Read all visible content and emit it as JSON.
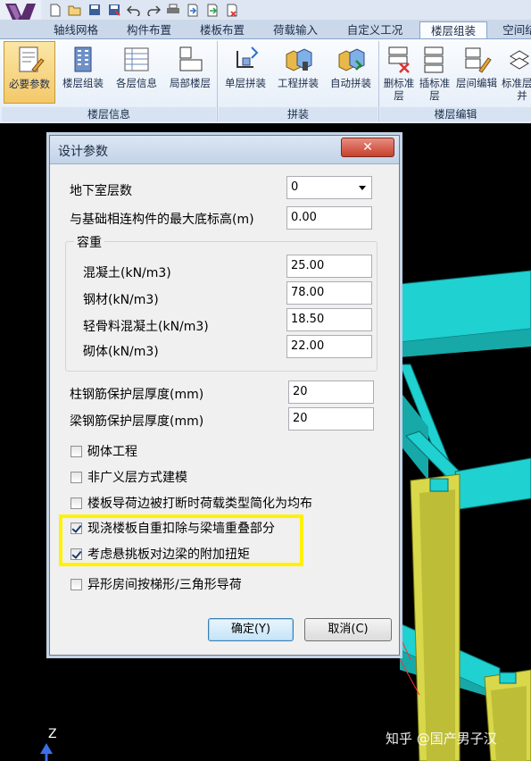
{
  "quick_access": {
    "icons": [
      "new-icon",
      "open-icon",
      "save-icon",
      "save-as-icon",
      "undo-icon",
      "redo-icon",
      "print-icon",
      "import-icon",
      "export-icon",
      "delete-file-icon"
    ]
  },
  "tabs": [
    {
      "label": "轴线网格"
    },
    {
      "label": "构件布置"
    },
    {
      "label": "楼板布置"
    },
    {
      "label": "荷载输入"
    },
    {
      "label": "自定义工况"
    },
    {
      "label": "楼层组装"
    },
    {
      "label": "空间结"
    }
  ],
  "ribbon": {
    "groups": [
      {
        "label": "楼层信息"
      },
      {
        "label": "拼装"
      },
      {
        "label": "楼层编辑"
      }
    ],
    "buttons": [
      {
        "label": "必要参数"
      },
      {
        "label": "楼层组装"
      },
      {
        "label": "各层信息"
      },
      {
        "label": "局部楼层"
      },
      {
        "label": "单层拼装"
      },
      {
        "label": "工程拼装"
      },
      {
        "label": "自动拼装"
      },
      {
        "label": "删标准层"
      },
      {
        "label": "插标准层"
      },
      {
        "label": "层间编辑"
      },
      {
        "label": "标准层合并"
      }
    ],
    "accent": "#f4c869"
  },
  "dialog": {
    "title": "设计参数",
    "close_label": "✕",
    "basement_label": "地下室层数",
    "basement_value": "0",
    "max_bottom_label": "与基础相连构件的最大底标高(m)",
    "max_bottom_value": "0.00",
    "density_group": "容重",
    "concrete_label": "混凝土(kN/m3)",
    "concrete_value": "25.00",
    "steel_label": "钢材(kN/m3)",
    "steel_value": "78.00",
    "lightweight_label": "轻骨料混凝土(kN/m3)",
    "lightweight_value": "18.50",
    "masonry_label": "砌体(kN/m3)",
    "masonry_value": "22.00",
    "col_cover_label": "柱钢筋保护层厚度(mm)",
    "col_cover_value": "20",
    "beam_cover_label": "梁钢筋保护层厚度(mm)",
    "beam_cover_value": "20",
    "checkboxes": [
      {
        "label": "砌体工程",
        "checked": false
      },
      {
        "label": "非广义层方式建模",
        "checked": false
      },
      {
        "label": "楼板导荷边被打断时荷载类型简化为均布",
        "checked": false
      },
      {
        "label": "现浇楼板自重扣除与梁墙重叠部分",
        "checked": true
      },
      {
        "label": "考虑悬挑板对边梁的附加扭矩",
        "checked": true
      },
      {
        "label": "异形房间按梯形/三角形导荷",
        "checked": false
      }
    ],
    "ok_label": "确定(Y)",
    "cancel_label": "取消(C)",
    "highlight_color": "#fff200"
  },
  "viewport": {
    "axis_label": "Z",
    "watermark": "知乎 @国产男子汉",
    "beam_color": "#1fd1d1",
    "column_color": "#d8d84a"
  }
}
